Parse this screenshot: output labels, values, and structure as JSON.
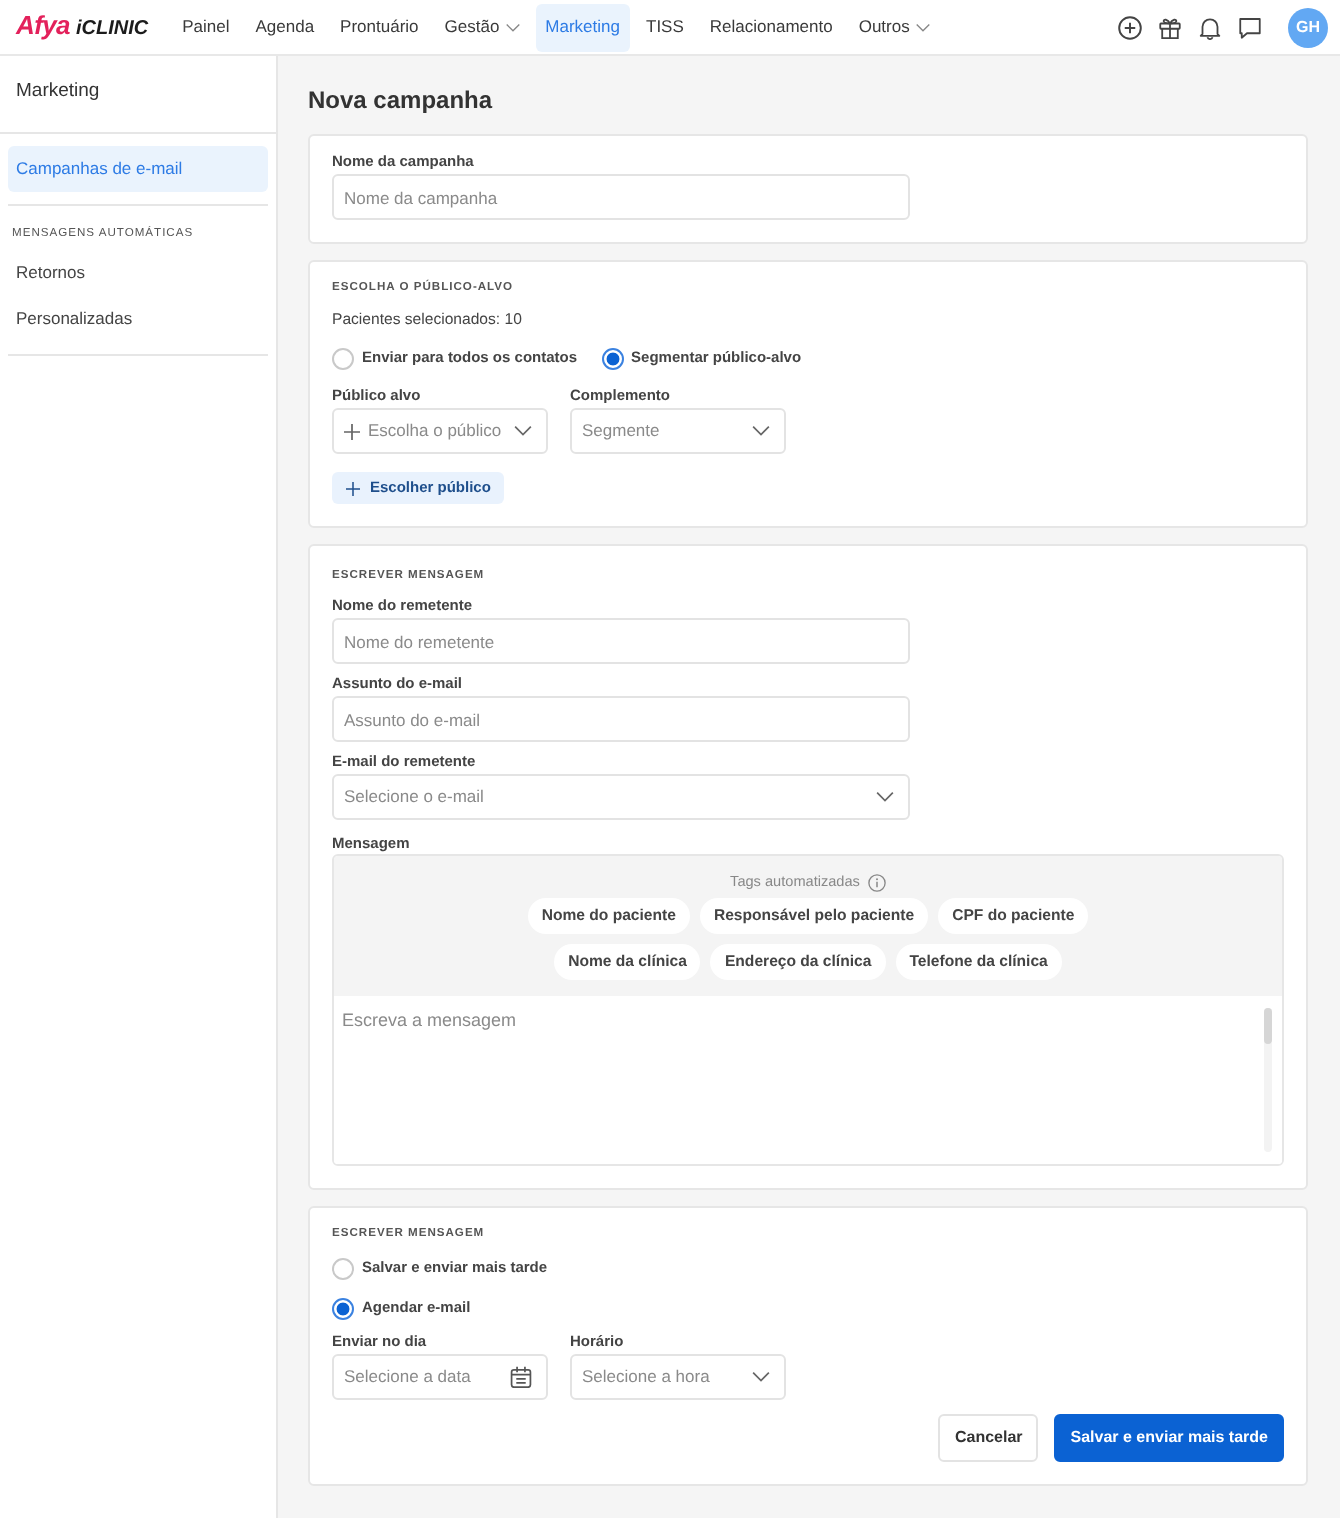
{
  "navbar": {
    "logo": {
      "brand": "Afya",
      "product": "iCLINIC"
    },
    "items": [
      {
        "label": "Painel",
        "selected": false,
        "dropdown": false
      },
      {
        "label": "Agenda",
        "selected": false,
        "dropdown": false
      },
      {
        "label": "Prontuário",
        "selected": false,
        "dropdown": false
      },
      {
        "label": "Gestão",
        "selected": false,
        "dropdown": true
      },
      {
        "label": "Marketing",
        "selected": true,
        "dropdown": false
      },
      {
        "label": "TISS",
        "selected": false,
        "dropdown": false
      },
      {
        "label": "Relacionamento",
        "selected": false,
        "dropdown": false
      },
      {
        "label": "Outros",
        "selected": false,
        "dropdown": true
      }
    ],
    "avatar": "GH"
  },
  "sidebar": {
    "title": "Marketing",
    "groups": [
      {
        "items": [
          {
            "label": "Campanhas de e-mail",
            "selected": true
          }
        ]
      },
      {
        "heading": "MENSAGENS AUTOMÁTICAS",
        "items": [
          {
            "label": "Retornos",
            "selected": false
          },
          {
            "label": "Personalizadas",
            "selected": false
          }
        ]
      }
    ]
  },
  "page_title": "Nova campanha",
  "campaign_card": {
    "field": {
      "label": "Nome da campanha",
      "placeholder": "Nome da campanha",
      "kind": "text"
    }
  },
  "audience_card": {
    "heading": "ESCOLHA O PÚBLICO-ALVO",
    "selected_count": "Pacientes selecionados: 10",
    "options": [
      {
        "label": "Enviar para todos os contatos",
        "selected": false
      },
      {
        "label": "Segmentar público-alvo",
        "selected": true
      }
    ],
    "fields": [
      {
        "label": "Público alvo",
        "placeholder": "Escolha o público",
        "kind": "add-select"
      },
      {
        "label": "Complemento",
        "placeholder": "Segmente",
        "kind": "select"
      }
    ],
    "button": "Escolher público"
  },
  "message_card": {
    "heading": "ESCREVER MENSAGEM",
    "fields": [
      {
        "label": "Nome do remetente",
        "placeholder": "Nome do remetente",
        "kind": "text"
      },
      {
        "label": "Assunto do e-mail",
        "placeholder": "Assunto do e-mail",
        "kind": "text"
      },
      {
        "label": "E-mail do remetente",
        "placeholder": "Selecione o e-mail",
        "kind": "select"
      }
    ],
    "message": {
      "label": "Mensagem",
      "tags_title": "Tags automatizadas",
      "tag_rows": [
        [
          "Nome do paciente",
          "Responsável pelo paciente",
          "CPF do paciente"
        ],
        [
          "Nome da clínica",
          "Endereço da clínica",
          "Telefone da clínica"
        ]
      ],
      "placeholder": "Escreva a mensagem"
    }
  },
  "schedule_card": {
    "heading": "ESCREVER MENSAGEM",
    "options": [
      {
        "label": "Salvar e enviar mais tarde",
        "selected": false
      },
      {
        "label": "Agendar e-mail",
        "selected": true
      }
    ],
    "fields": [
      {
        "label": "Enviar no dia",
        "placeholder": "Selecione a data",
        "kind": "date"
      },
      {
        "label": "Horário",
        "placeholder": "Selecione a hora",
        "kind": "select"
      }
    ],
    "buttons": [
      {
        "label": "Cancelar",
        "kind": "secondary"
      },
      {
        "label": "Salvar e enviar mais tarde",
        "kind": "primary"
      }
    ]
  }
}
